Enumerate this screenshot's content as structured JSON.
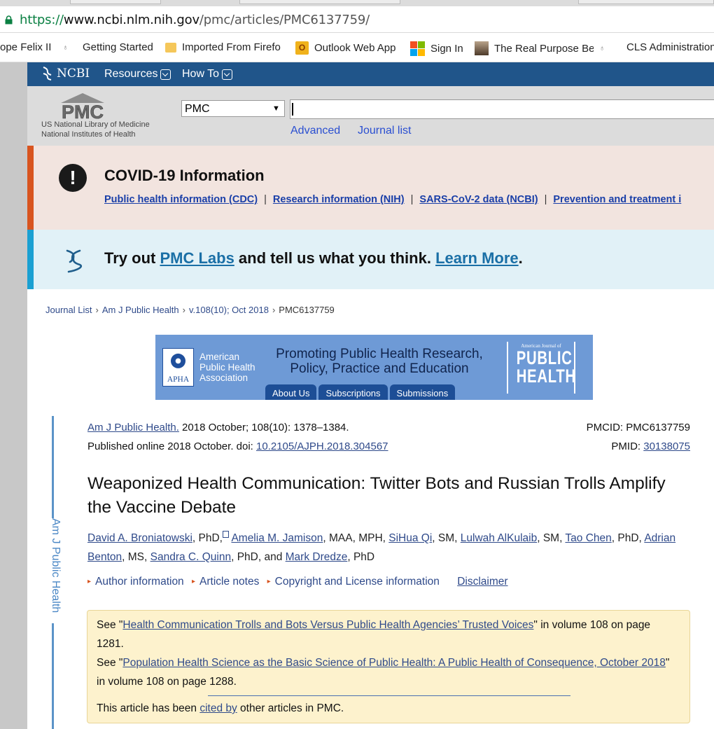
{
  "browser": {
    "url_scheme": "https://",
    "url_host": "www.ncbi.nlm.nih.gov",
    "url_path": "/pmc/articles/PMC6137759/",
    "bookmarks": [
      {
        "label": "ope Felix II",
        "icon": "bookmark-dot-icon"
      },
      {
        "label": "Getting Started",
        "icon": "firefox-icon"
      },
      {
        "label": "Imported From Firefo",
        "icon": "folder-icon"
      },
      {
        "label": "Outlook Web App",
        "icon": "outlook-icon"
      },
      {
        "label": "Sign In",
        "icon": "microsoft-icon"
      },
      {
        "label": "The Real Purpose Beh",
        "icon": "page-thumbnail-icon"
      },
      {
        "label": "CLS Administration",
        "icon": "bookmark-dot-icon"
      }
    ]
  },
  "ncbi": {
    "logo_text": "NCBI",
    "resources_label": "Resources",
    "howto_label": "How To"
  },
  "pmc_header": {
    "logo_text": "PMC",
    "nlm_line1": "US National Library of Medicine",
    "nlm_line2": "National Institutes of Health",
    "db_selected": "PMC",
    "search_value": "",
    "advanced_label": "Advanced",
    "journal_list_label": "Journal list"
  },
  "covid": {
    "heading": "COVID-19 Information",
    "links": [
      "Public health information (CDC)",
      "Research information (NIH)",
      "SARS-CoV-2 data (NCBI)",
      "Prevention and treatment i"
    ],
    "separator": "|"
  },
  "labs": {
    "prefix": "Try out ",
    "labs_link": "PMC Labs",
    "middle": " and tell us what you think. ",
    "learn_link": "Learn More",
    "suffix": "."
  },
  "breadcrumb": {
    "items": [
      "Journal List",
      "Am J Public Health",
      "v.108(10); Oct 2018",
      "PMC6137759"
    ],
    "sep": "›"
  },
  "apha_banner": {
    "org_line1": "American",
    "org_line2": "Public Health",
    "org_line3": "Association",
    "badge_text": "APHA",
    "promo_line1": "Promoting Public Health Research,",
    "promo_line2": "Policy, Practice and Education",
    "tabs": [
      "About Us",
      "Subscriptions",
      "Submissions"
    ],
    "journal_small": "American Journal of",
    "journal_big1": "PUBLIC",
    "journal_big2": "HEALTH"
  },
  "rail_label": "Am J Public Health",
  "article": {
    "journal_link": "Am J Public Health.",
    "citation": " 2018 October; 108(10): 1378–1384.",
    "pmcid_label": "PMCID: PMC6137759",
    "published_prefix": "Published online 2018 October. doi: ",
    "doi": "10.2105/AJPH.2018.304567",
    "pmid_label": "PMID: ",
    "pmid": "30138075",
    "title": "Weaponized Health Communication: Twitter Bots and Russian Trolls Amplify the Vaccine Debate",
    "authors": [
      {
        "name": "David A. Broniatowski",
        "suffix": ", PhD,"
      },
      {
        "name": "Amelia M. Jamison",
        "suffix": ", MAA, MPH, "
      },
      {
        "name": "SiHua Qi",
        "suffix": ", SM, "
      },
      {
        "name": "Lulwah AlKulaib",
        "suffix": ", SM, "
      },
      {
        "name": "Tao Chen",
        "suffix": ", PhD, "
      },
      {
        "name": "Adrian Benton",
        "suffix": ", MS, "
      },
      {
        "name": "Sandra C. Quinn",
        "suffix": ", PhD, and "
      },
      {
        "name": "Mark Dredze",
        "suffix": ", PhD"
      }
    ],
    "info_links": [
      "Author information",
      "Article notes",
      "Copyright and License information"
    ],
    "disclaimer": "Disclaimer"
  },
  "notice": {
    "see1_prefix": "See \"",
    "see1_link": "Health Communication Trolls and Bots Versus Public Health Agencies’ Trusted Voices",
    "see1_suffix": "\" in volume 108 on page 1281.",
    "see2_prefix": "See \"",
    "see2_link": "Population Health Science as the Basic Science of Public Health: A Public Health of Consequence, October 2018",
    "see2_suffix": "\" in volume 108 on page 1288.",
    "cited_prefix": "This article has been ",
    "cited_link": "cited by",
    "cited_suffix": " other articles in PMC."
  },
  "colors": {
    "ncbi_bar": "#20558a",
    "covid_accent": "#d8541f",
    "labs_accent": "#1aa0d2",
    "notice_bg": "#fdf2cd"
  }
}
